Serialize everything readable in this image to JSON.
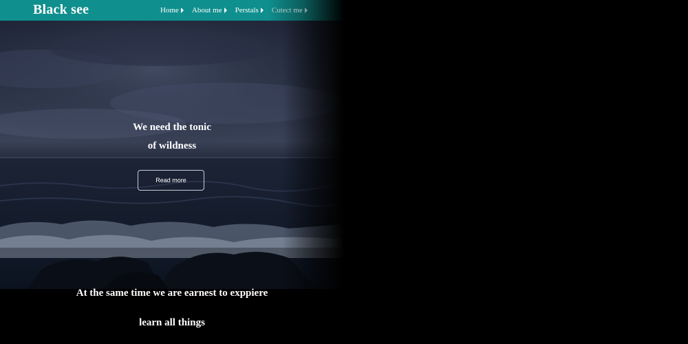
{
  "brand": {
    "name": "Black see"
  },
  "nav": {
    "items": [
      {
        "label": "Home"
      },
      {
        "label": "About me"
      },
      {
        "label": "Perstals"
      },
      {
        "label": "Cutect me"
      }
    ]
  },
  "hero": {
    "headline_line1": "We need the tonic",
    "headline_line2": "of wildness",
    "button_label": "Read more"
  },
  "footer_text": {
    "line1": "At the same time we are earnest to exppiere",
    "line2": "learn all things"
  },
  "colors": {
    "navbar": "#0f8f8d",
    "background": "#000000",
    "text": "#ffffff"
  }
}
